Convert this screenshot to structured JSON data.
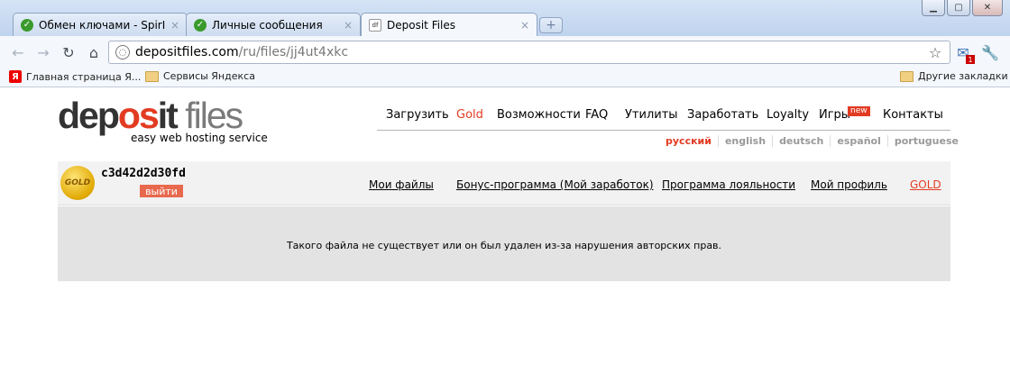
{
  "browser": {
    "tabs": [
      {
        "title": "Обмен ключами - SpirITix ...",
        "close": "×"
      },
      {
        "title": "Личные сообщения",
        "close": "×"
      },
      {
        "title": "Deposit Files",
        "close": "×"
      }
    ],
    "new_tab": "+",
    "address": {
      "host": "depositfiles.com",
      "path": "/ru/files/jj4ut4xkc"
    },
    "mail_count": "1",
    "bookmarks": [
      {
        "label": "Главная страница Я..."
      },
      {
        "label": "Сервисы Яндекса"
      }
    ],
    "other_bookmarks": "Другие закладки"
  },
  "logo": {
    "part1": "dep",
    "part2": "os",
    "part3": "it",
    "part4": " files",
    "tagline": "easy web hosting service"
  },
  "topnav": [
    {
      "label": "Загрузить"
    },
    {
      "label": "Gold"
    },
    {
      "label": "Возможности"
    },
    {
      "label": "FAQ"
    },
    {
      "label": "Утилиты"
    },
    {
      "label": "Заработать"
    },
    {
      "label": "Loyalty"
    },
    {
      "label": "Игры"
    },
    {
      "label": "Контакты"
    }
  ],
  "new_badge": "new",
  "languages": [
    "русский",
    "english",
    "deutsch",
    "español",
    "portuguese"
  ],
  "user": {
    "coin_label": "GOLD",
    "username": "c3d42d2d30fd",
    "logout": "выйти"
  },
  "usernav": [
    {
      "label": "Мои файлы"
    },
    {
      "label": "Бонус-программа (Мой заработок)"
    },
    {
      "label": "Программа лояльности"
    },
    {
      "label": "Мой профиль"
    },
    {
      "label": "GOLD"
    }
  ],
  "message": "Такого файла не существует или он был удален из-за нарушения авторских прав.",
  "colors": {
    "accent": "#e23b22",
    "panel": "#e3e3e3"
  }
}
